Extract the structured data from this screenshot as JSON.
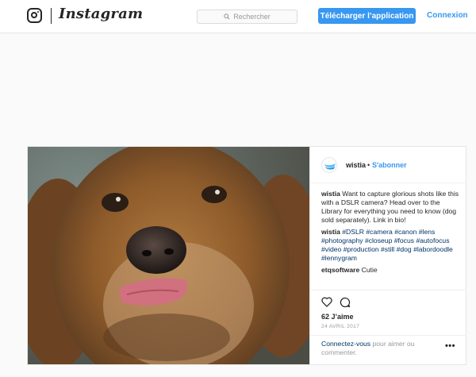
{
  "header": {
    "brand": "Instagram",
    "search_placeholder": "Rechercher",
    "download_label": "Télécharger l’application",
    "login_label": "Connexion"
  },
  "post": {
    "account": "wistia",
    "separator": "•",
    "follow_label": "S'abonner",
    "caption": {
      "user": "wistia",
      "text": "Want to capture glorious shots like this with a DSLR camera? Head over to the Library for everything you need to know (dog sold separately). Link in bio!"
    },
    "hashtag_comment": {
      "user": "wistia",
      "tags": "#DSLR #camera #canon #lens #photography #closeup #focus #autofocus #video #production #still #dog #labordoodle #lennygram"
    },
    "reply": {
      "user": "etqsoftware",
      "text": "Cutie"
    },
    "likes": "62 J’aime",
    "date": "24 AVRIL 2017",
    "login_prompt": {
      "link": "Connectez-vous",
      "text": "pour aimer ou commenter."
    },
    "more_label": "•••"
  },
  "icons": {
    "instagram": "instagram-camera-icon",
    "search": "search-icon",
    "like": "heart-icon",
    "comment": "comment-bubble-icon",
    "more": "more-options-icon"
  },
  "colors": {
    "accent": "#3897f0",
    "hashtag": "#003569",
    "muted": "#999999",
    "text": "#262626"
  }
}
